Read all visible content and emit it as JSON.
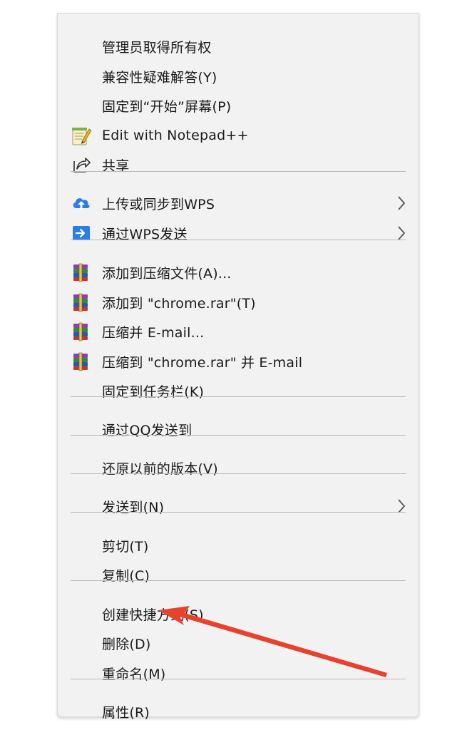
{
  "menu": {
    "items": [
      {
        "label": "管理员取得所有权"
      },
      {
        "label": "兼容性疑难解答(Y)"
      },
      {
        "label": "固定到“开始”屏幕(P)"
      },
      {
        "label": "Edit with Notepad++",
        "icon": "notepadpp-icon"
      },
      {
        "label": "共享",
        "icon": "share-icon"
      },
      {
        "label": "上传或同步到WPS",
        "icon": "cloud-upload-icon",
        "submenu": true
      },
      {
        "label": "通过WPS发送",
        "icon": "wps-send-icon",
        "submenu": true
      },
      {
        "label": "添加到压缩文件(A)...",
        "icon": "winrar-icon"
      },
      {
        "label": "添加到 \"chrome.rar\"(T)",
        "icon": "winrar-icon"
      },
      {
        "label": "压缩并 E-mail...",
        "icon": "winrar-icon"
      },
      {
        "label": "压缩到 \"chrome.rar\" 并 E-mail",
        "icon": "winrar-icon"
      },
      {
        "label": "固定到任务栏(K)"
      },
      {
        "label": "通过QQ发送到"
      },
      {
        "label": "还原以前的版本(V)"
      },
      {
        "label": "发送到(N)",
        "submenu": true
      },
      {
        "label": "剪切(T)"
      },
      {
        "label": "复制(C)"
      },
      {
        "label": "创建快捷方式(S)"
      },
      {
        "label": "删除(D)"
      },
      {
        "label": "重命名(M)"
      },
      {
        "label": "属性(R)"
      }
    ]
  },
  "annotation": {
    "color": "#e8412c",
    "target": "创建快捷方式(S)"
  },
  "colors": {
    "menu_bg": "#f2f2f2",
    "separator": "#b8b8b8",
    "text": "#1a1a1a",
    "wps_blue": "#2b7de9"
  }
}
